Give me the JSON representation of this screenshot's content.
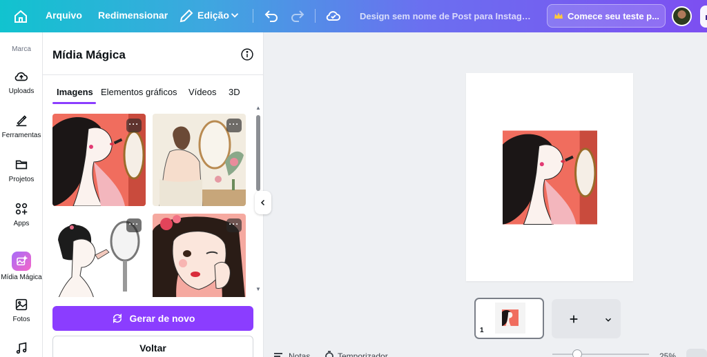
{
  "topbar": {
    "file_label": "Arquivo",
    "resize_label": "Redimensionar",
    "edit_label": "Edição",
    "doc_title": "Design sem nome de Post para Instagra...",
    "trial_label": "Comece seu teste p..."
  },
  "rail": {
    "brand_label": "Marca",
    "items": [
      {
        "label": "Uploads"
      },
      {
        "label": "Ferramentas"
      },
      {
        "label": "Projetos"
      },
      {
        "label": "Apps"
      },
      {
        "label": "Mídia Mágica"
      },
      {
        "label": "Fotos"
      }
    ]
  },
  "panel": {
    "title": "Mídia Mágica",
    "tabs": [
      {
        "label": "Imagens",
        "active": true
      },
      {
        "label": "Elementos gráficos"
      },
      {
        "label": "Vídeos"
      },
      {
        "label": "3D"
      }
    ],
    "more_label": "···",
    "regenerate_label": "Gerar de novo",
    "back_label": "Voltar"
  },
  "pages": {
    "current_page_number": "1"
  },
  "bottom": {
    "notes_label": "Notas",
    "timer_label": "Temporizador",
    "zoom": "25%"
  },
  "colors": {
    "accent": "#8b3dff",
    "topbar_start": "#11c3cf",
    "topbar_end": "#7d4ff1"
  }
}
